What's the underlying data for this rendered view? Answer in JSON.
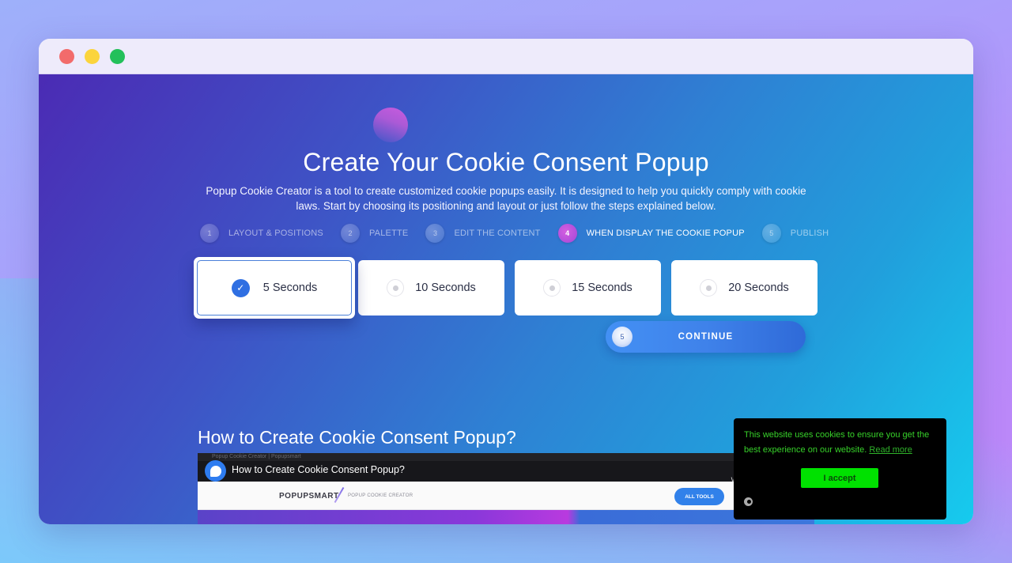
{
  "window": {
    "controls": [
      "close",
      "minimize",
      "maximize"
    ]
  },
  "hero": {
    "title": "Create Your Cookie Consent Popup",
    "subtitle": "Popup Cookie Creator is a tool to create customized cookie popups easily. It is designed to help you quickly comply with cookie laws. Start by choosing its positioning and layout or just follow the steps explained below."
  },
  "steps": [
    {
      "number": "1",
      "label": "LAYOUT & POSITIONS",
      "active": false
    },
    {
      "number": "2",
      "label": "PALETTE",
      "active": false
    },
    {
      "number": "3",
      "label": "EDIT THE CONTENT",
      "active": false
    },
    {
      "number": "4",
      "label": "WHEN DISPLAY THE COOKIE POPUP",
      "active": true
    },
    {
      "number": "5",
      "label": "PUBLISH",
      "active": false
    }
  ],
  "options": [
    {
      "label": "5 Seconds",
      "selected": true
    },
    {
      "label": "10 Seconds",
      "selected": false
    },
    {
      "label": "15 Seconds",
      "selected": false
    },
    {
      "label": "20 Seconds",
      "selected": false
    }
  ],
  "continue_button": {
    "badge": "5",
    "label": "CONTINUE"
  },
  "video_section": {
    "title": "How to Create Cookie Consent Popup?",
    "video_title": "How to Create Cookie Consent Popup?",
    "tab_text": "Popup Cookie Creator | Popupsmart",
    "watermark": "We",
    "brand": "POPUPSMART",
    "brand_sub": "POPUP COOKIE CREATOR",
    "all_tools": "ALL TOOLS"
  },
  "cookie_banner": {
    "message": "This website uses cookies to ensure you get the best experience on our website.",
    "link_text": "Read more",
    "accept_label": "I accept",
    "colors": {
      "background": "#000000",
      "text": "#37d12a",
      "button": "#00e100"
    }
  }
}
